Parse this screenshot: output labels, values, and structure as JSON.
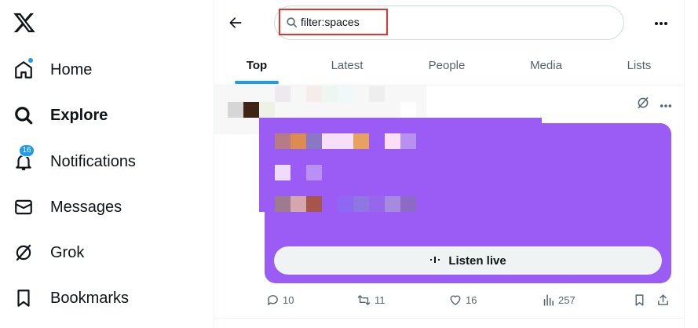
{
  "colors": {
    "accent": "#1d9bf0",
    "space_card": "#9a5cf5",
    "highlight": "#e0362c"
  },
  "nav": {
    "items": [
      {
        "label": "Home",
        "icon": "home-icon"
      },
      {
        "label": "Explore",
        "icon": "search-icon",
        "active": true
      },
      {
        "label": "Notifications",
        "icon": "bell-icon",
        "badge": "16"
      },
      {
        "label": "Messages",
        "icon": "envelope-icon"
      },
      {
        "label": "Grok",
        "icon": "grok-icon"
      },
      {
        "label": "Bookmarks",
        "icon": "bookmark-icon"
      }
    ]
  },
  "search": {
    "value": "filter:spaces"
  },
  "tabs": [
    {
      "label": "Top",
      "active": true
    },
    {
      "label": "Latest"
    },
    {
      "label": "People"
    },
    {
      "label": "Media"
    },
    {
      "label": "Lists"
    }
  ],
  "post": {
    "listen_label": "Listen live",
    "stats": {
      "replies": "10",
      "reposts": "11",
      "likes": "16",
      "views": "257"
    }
  }
}
